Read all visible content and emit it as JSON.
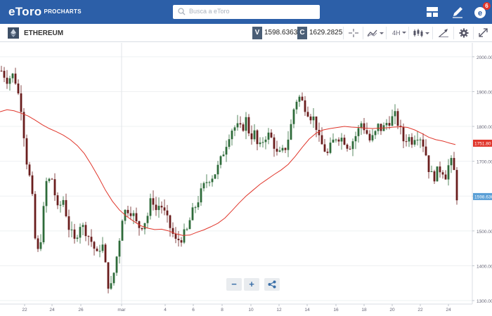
{
  "header": {
    "logo": "eToro",
    "logo_sub": "PROCHARTS",
    "search_placeholder": "Busca a eToro",
    "notification_count": "6"
  },
  "toolbar": {
    "instrument": "ETHEREUM",
    "sell": {
      "tag": "V",
      "value": "1598.6363"
    },
    "buy": {
      "tag": "C",
      "value": "1629.2825"
    },
    "timeframe": "4H"
  },
  "chart_data": {
    "type": "candlestick",
    "instrument": "ETHEREUM",
    "timeframe": "4H",
    "ylim": [
      1290,
      2040
    ],
    "yticks": [
      1300,
      1400,
      1500,
      1600,
      1700,
      1800,
      1900,
      2000
    ],
    "ytick_labels": [
      "1300.00",
      "1400.00",
      "1500.00",
      "1600.00",
      "1700.00",
      "1800.00",
      "1900.00",
      "2000.00"
    ],
    "xtick_labels": [
      "22",
      "24",
      "26",
      "mar",
      "4",
      "6",
      "8",
      "10",
      "12",
      "14",
      "16",
      "18",
      "20",
      "22",
      "24"
    ],
    "current_price_label": "1598.6363",
    "ma_label": "1751.80",
    "colors": {
      "up": "#2e6b3a",
      "down": "#6a1d1d",
      "ma": "#e0362b",
      "price_tag": "#5a9fd6",
      "ma_tag": "#e0362b"
    },
    "ma_line": [
      [
        0,
        1842
      ],
      [
        10,
        1848
      ],
      [
        20,
        1845
      ],
      [
        30,
        1838
      ],
      [
        40,
        1830
      ],
      [
        50,
        1818
      ],
      [
        60,
        1805
      ],
      [
        70,
        1794
      ],
      [
        80,
        1785
      ],
      [
        90,
        1775
      ],
      [
        100,
        1762
      ],
      [
        110,
        1745
      ],
      [
        120,
        1722
      ],
      [
        130,
        1690
      ],
      [
        140,
        1655
      ],
      [
        150,
        1617
      ],
      [
        160,
        1585
      ],
      [
        170,
        1560
      ],
      [
        180,
        1542
      ],
      [
        190,
        1528
      ],
      [
        200,
        1515
      ],
      [
        210,
        1508
      ],
      [
        220,
        1504
      ],
      [
        230,
        1505
      ],
      [
        240,
        1500
      ],
      [
        250,
        1492
      ],
      [
        260,
        1487
      ],
      [
        270,
        1488
      ],
      [
        280,
        1496
      ],
      [
        290,
        1503
      ],
      [
        300,
        1512
      ],
      [
        310,
        1522
      ],
      [
        320,
        1537
      ],
      [
        330,
        1558
      ],
      [
        340,
        1580
      ],
      [
        350,
        1600
      ],
      [
        360,
        1617
      ],
      [
        370,
        1634
      ],
      [
        380,
        1648
      ],
      [
        390,
        1662
      ],
      [
        400,
        1675
      ],
      [
        410,
        1691
      ],
      [
        420,
        1714
      ],
      [
        430,
        1740
      ],
      [
        440,
        1764
      ],
      [
        450,
        1781
      ],
      [
        460,
        1790
      ],
      [
        470,
        1794
      ],
      [
        480,
        1797
      ],
      [
        490,
        1800
      ],
      [
        500,
        1798
      ],
      [
        510,
        1797
      ],
      [
        520,
        1795
      ],
      [
        530,
        1794
      ],
      [
        540,
        1795
      ],
      [
        550,
        1796
      ],
      [
        560,
        1798
      ],
      [
        570,
        1799
      ],
      [
        580,
        1797
      ],
      [
        590,
        1790
      ],
      [
        600,
        1780
      ],
      [
        610,
        1769
      ],
      [
        620,
        1762
      ],
      [
        630,
        1758
      ],
      [
        640,
        1752
      ],
      [
        648,
        1748
      ]
    ]
  },
  "zoom": {
    "minus": "−",
    "plus": "+"
  }
}
